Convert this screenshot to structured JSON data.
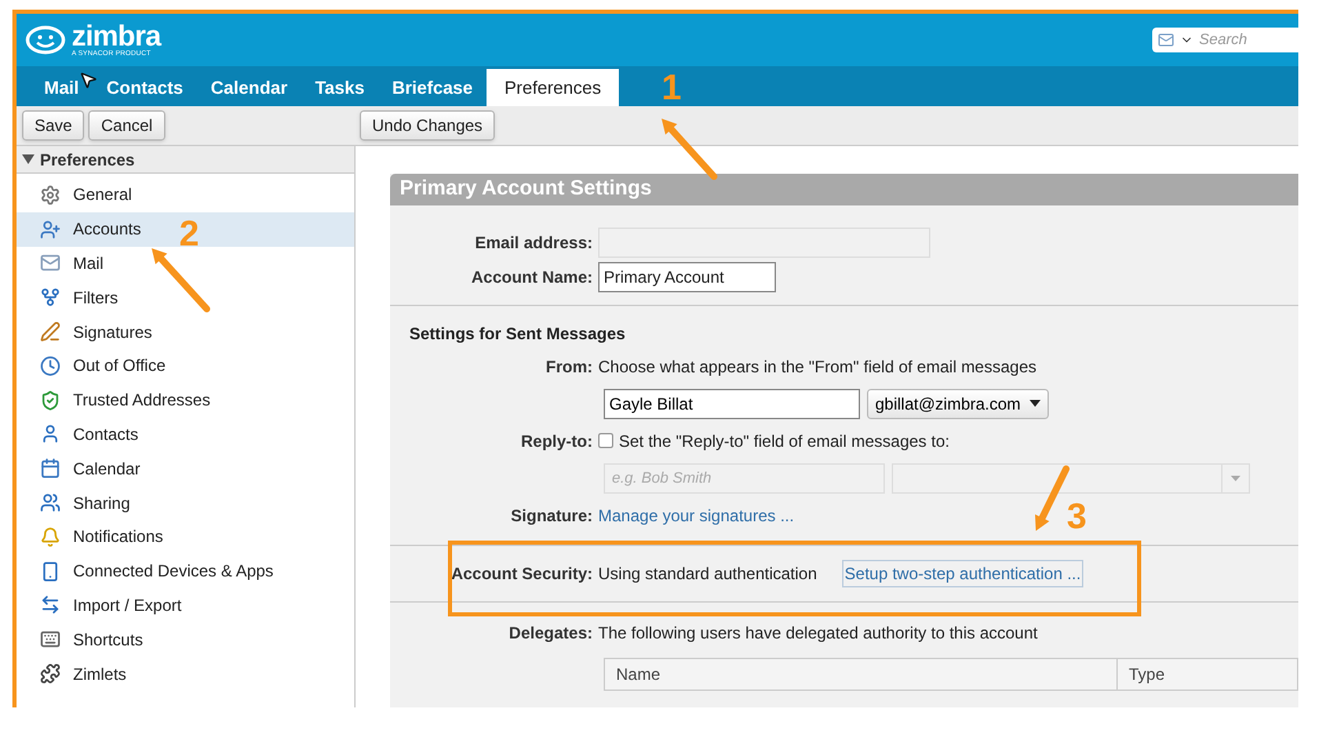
{
  "app": {
    "logo": "zimbra",
    "tagline": "A SYNACOR PRODUCT"
  },
  "search": {
    "placeholder": "Search"
  },
  "tabs": [
    {
      "label": "Mail",
      "selected": false
    },
    {
      "label": "Contacts",
      "selected": false
    },
    {
      "label": "Calendar",
      "selected": false
    },
    {
      "label": "Tasks",
      "selected": false
    },
    {
      "label": "Briefcase",
      "selected": false
    },
    {
      "label": "Preferences",
      "selected": true
    }
  ],
  "toolbar": {
    "left_buttons": [
      "Save",
      "Cancel"
    ],
    "right_buttons": [
      "Undo Changes"
    ]
  },
  "sidebar": {
    "header": "Preferences",
    "expanded": true,
    "items": [
      {
        "label": "General",
        "selected": false
      },
      {
        "label": "Accounts",
        "selected": true
      },
      {
        "label": "Mail",
        "selected": false
      },
      {
        "label": "Filters",
        "selected": false
      },
      {
        "label": "Signatures",
        "selected": false
      },
      {
        "label": "Out of Office",
        "selected": false
      },
      {
        "label": "Trusted Addresses",
        "selected": false
      },
      {
        "label": "Contacts",
        "selected": false
      },
      {
        "label": "Calendar",
        "selected": false
      },
      {
        "label": "Sharing",
        "selected": false
      },
      {
        "label": "Notifications",
        "selected": false
      },
      {
        "label": "Connected Devices & Apps",
        "selected": false
      },
      {
        "label": "Import / Export",
        "selected": false
      },
      {
        "label": "Shortcuts",
        "selected": false
      },
      {
        "label": "Zimlets",
        "selected": false
      }
    ]
  },
  "section": {
    "title": "Primary Account Settings",
    "email_label": "Email address:",
    "account_name_label": "Account Name:",
    "account_name": "Primary Account",
    "sent_heading": "Settings for Sent Messages",
    "from_label": "From:",
    "from_text": "Choose what appears in the \"From\" field of email messages",
    "from_name": "Gayle Billat",
    "from_address": "gbillat@zimbra.com",
    "reply_label": "Reply-to:",
    "reply_checked": false,
    "reply_text": "Set the \"Reply-to\" field of email messages to:",
    "reply_placeholder": "e.g. Bob Smith",
    "signature_label": "Signature:",
    "signature_link": "Manage your signatures ...",
    "security_label": "Account Security:",
    "security_text": "Using standard authentication",
    "security_link": "Setup two-step authentication ...",
    "delegates_label": "Delegates:",
    "delegates_text": "The following users have delegated authority to this account",
    "delegates_columns": [
      "Name",
      "Type"
    ]
  },
  "callouts": [
    {
      "label": "1"
    },
    {
      "label": "2"
    },
    {
      "label": "3"
    }
  ]
}
